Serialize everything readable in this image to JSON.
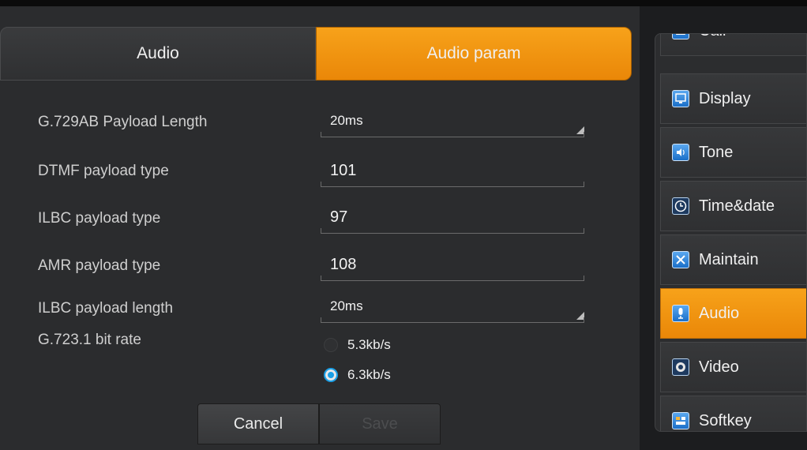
{
  "tabs": [
    {
      "label": "Audio",
      "active": false
    },
    {
      "label": "Audio param",
      "active": true
    }
  ],
  "form": {
    "g729_payload_length": {
      "label": "G.729AB Payload Length",
      "value": "20ms"
    },
    "dtmf_payload_type": {
      "label": "DTMF payload type",
      "value": "101"
    },
    "ilbc_payload_type": {
      "label": "ILBC payload type",
      "value": "97"
    },
    "amr_payload_type": {
      "label": "AMR payload type",
      "value": "108"
    },
    "ilbc_payload_length": {
      "label": "ILBC payload length",
      "value": "20ms"
    },
    "g7231_bit_rate": {
      "label": "G.723.1 bit rate",
      "options": [
        {
          "label": "5.3kb/s",
          "selected": false
        },
        {
          "label": "6.3kb/s",
          "selected": true
        }
      ]
    }
  },
  "buttons": {
    "cancel": "Cancel",
    "save": "Save"
  },
  "sidebar": {
    "items": [
      {
        "label": "Call",
        "icon": "phone-icon",
        "active": false
      },
      {
        "label": "Display",
        "icon": "monitor-icon",
        "active": false
      },
      {
        "label": "Tone",
        "icon": "speaker-icon",
        "active": false
      },
      {
        "label": "Time&date",
        "icon": "clock-icon",
        "active": false
      },
      {
        "label": "Maintain",
        "icon": "tools-icon",
        "active": false
      },
      {
        "label": "Audio",
        "icon": "microphone-icon",
        "active": true
      },
      {
        "label": "Video",
        "icon": "camera-icon",
        "active": false
      },
      {
        "label": "Softkey",
        "icon": "softkey-icon",
        "active": false
      }
    ]
  },
  "colors": {
    "accent": "#f29414",
    "radio_selected": "#1a9fe6",
    "background": "#2b2c2e"
  }
}
